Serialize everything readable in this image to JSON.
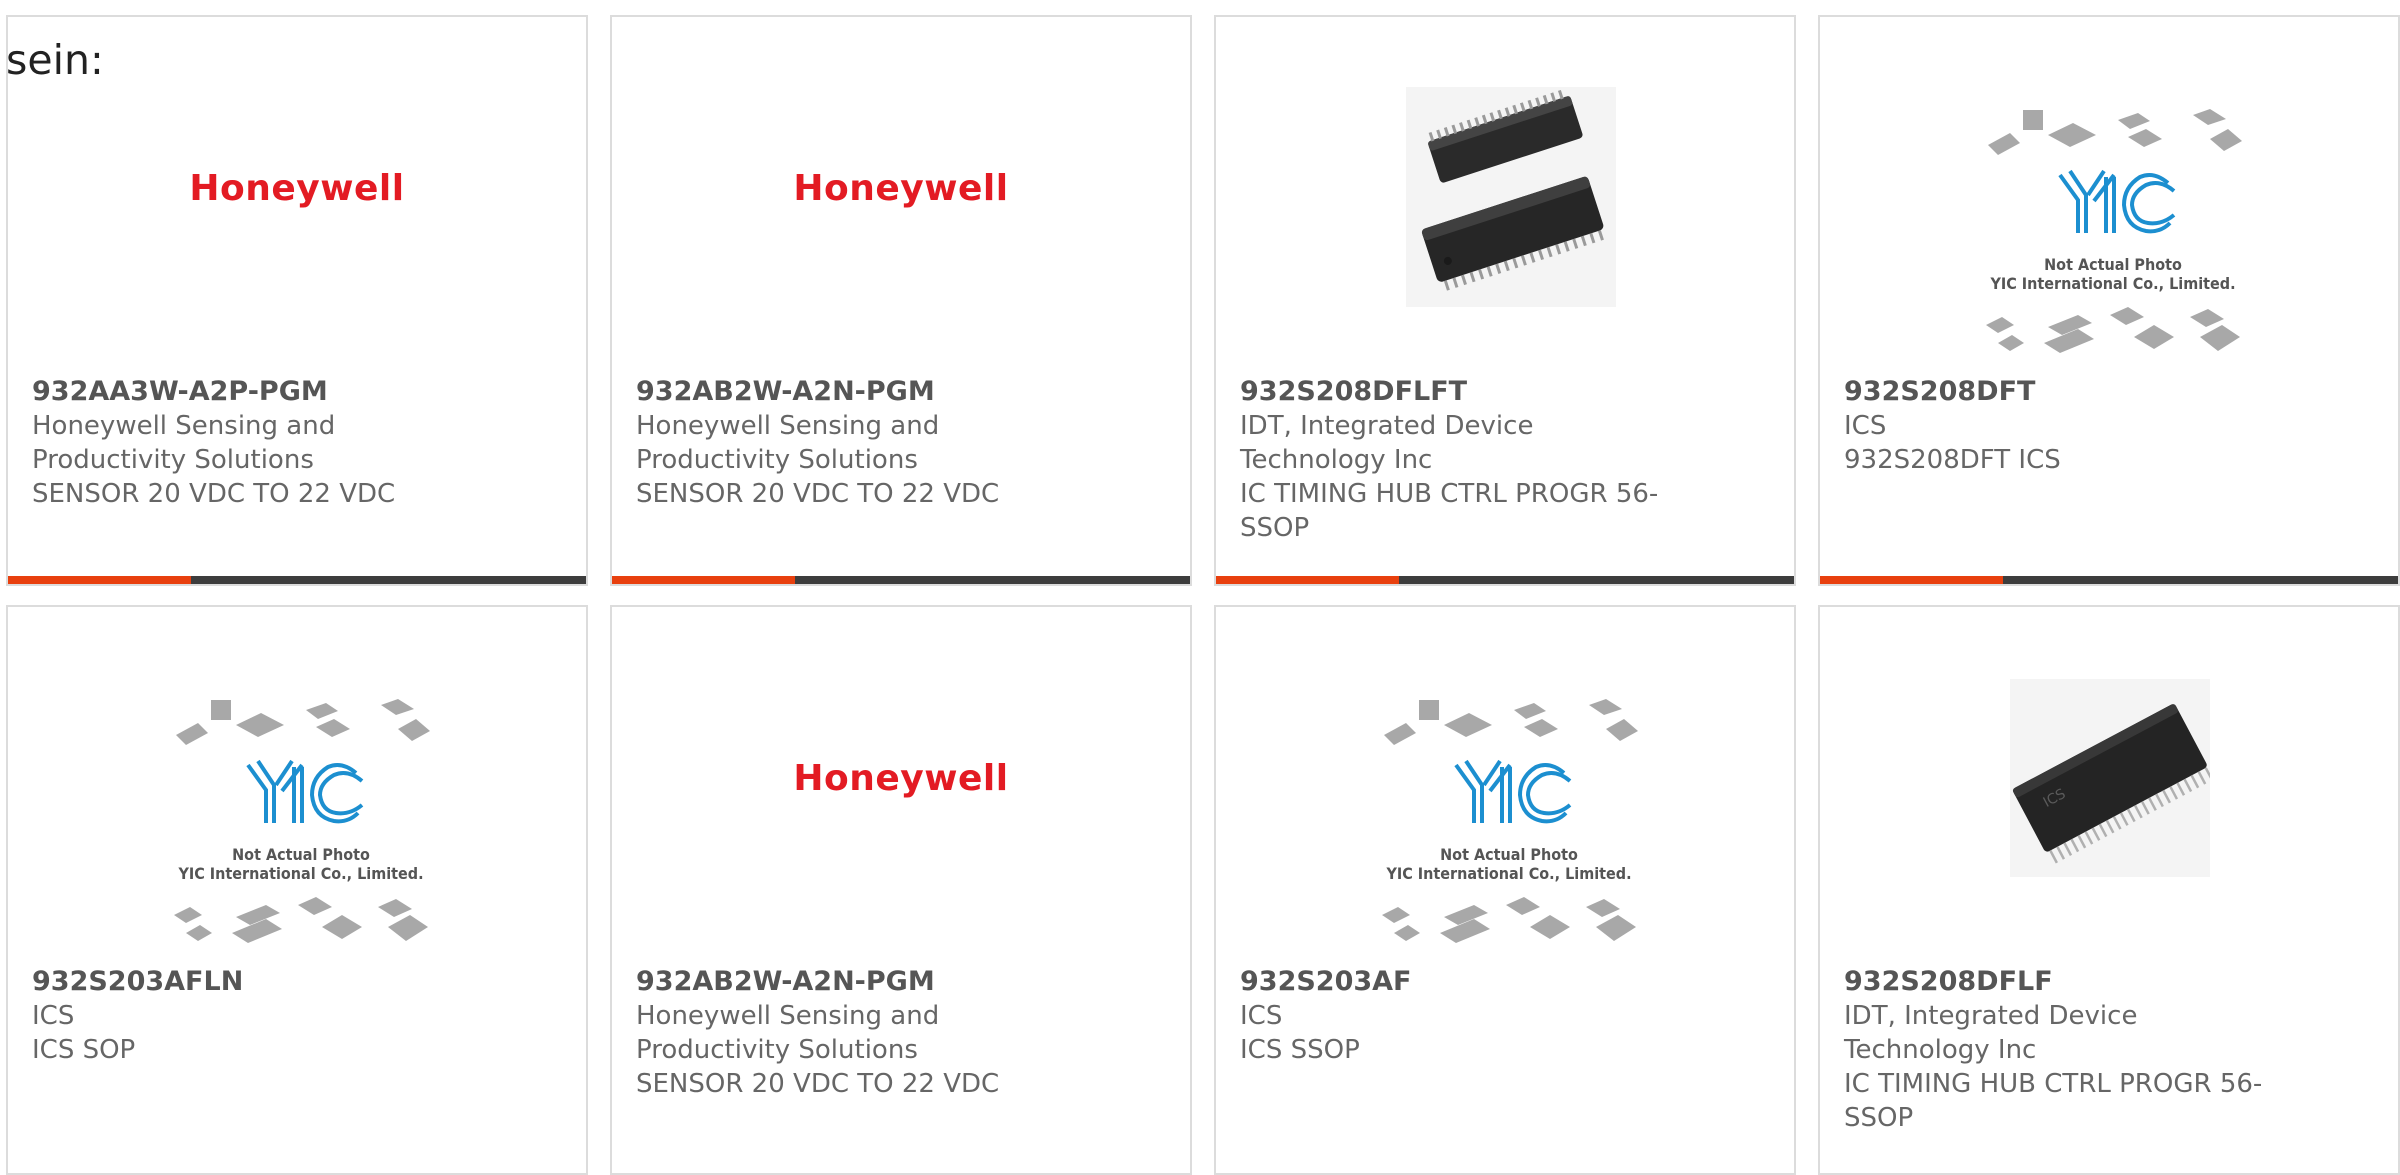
{
  "intro_text": "sein:",
  "colors": {
    "accent": "#e8400e",
    "bar": "#3d3d3d",
    "border": "#dcdcdc",
    "logo": "#e31b23",
    "yic_blue": "#1c8fd0"
  },
  "cards": [
    {
      "image": "honeywell-logo",
      "logo_text": "Honeywell",
      "part_number": "932AA3W-A2P-PGM",
      "maker_lines": [
        "Honeywell Sensing and",
        "Productivity Solutions"
      ],
      "desc_lines": [
        "SENSOR 20 VDC TO 22 VDC"
      ]
    },
    {
      "image": "honeywell-logo",
      "logo_text": "Honeywell",
      "part_number": "932AB2W-A2N-PGM",
      "maker_lines": [
        "Honeywell Sensing and",
        "Productivity Solutions"
      ],
      "desc_lines": [
        "SENSOR 20 VDC TO 22 VDC"
      ]
    },
    {
      "image": "ssop-chip-photo",
      "part_number": "932S208DFLFT",
      "maker_lines": [
        "IDT, Integrated Device",
        "Technology Inc"
      ],
      "desc_lines": [
        "IC TIMING HUB CTRL PROGR 56-",
        "SSOP"
      ]
    },
    {
      "image": "yic-placeholder",
      "yic_caption": [
        "Not Actual Photo",
        "YIC International Co., Limited."
      ],
      "part_number": "932S208DFT",
      "maker_lines": [
        "ICS"
      ],
      "desc_lines": [
        "932S208DFT ICS"
      ]
    },
    {
      "image": "yic-placeholder",
      "yic_caption": [
        "Not Actual Photo",
        "YIC International Co., Limited."
      ],
      "part_number": "932S203AFLN",
      "maker_lines": [
        "ICS"
      ],
      "desc_lines": [
        "ICS SOP"
      ]
    },
    {
      "image": "honeywell-logo",
      "logo_text": "Honeywell",
      "part_number": "932AB2W-A2N-PGM",
      "maker_lines": [
        "Honeywell Sensing and",
        "Productivity Solutions"
      ],
      "desc_lines": [
        "SENSOR 20 VDC TO 22 VDC"
      ]
    },
    {
      "image": "yic-placeholder",
      "yic_caption": [
        "Not Actual Photo",
        "YIC International Co., Limited."
      ],
      "part_number": "932S203AF",
      "maker_lines": [
        "ICS"
      ],
      "desc_lines": [
        "ICS SSOP"
      ]
    },
    {
      "image": "ics-chip-photo",
      "chip_marking": "ICS",
      "part_number": "932S208DFLF",
      "maker_lines": [
        "IDT, Integrated Device",
        "Technology Inc"
      ],
      "desc_lines": [
        "IC TIMING HUB CTRL PROGR 56-",
        "SSOP"
      ]
    }
  ]
}
